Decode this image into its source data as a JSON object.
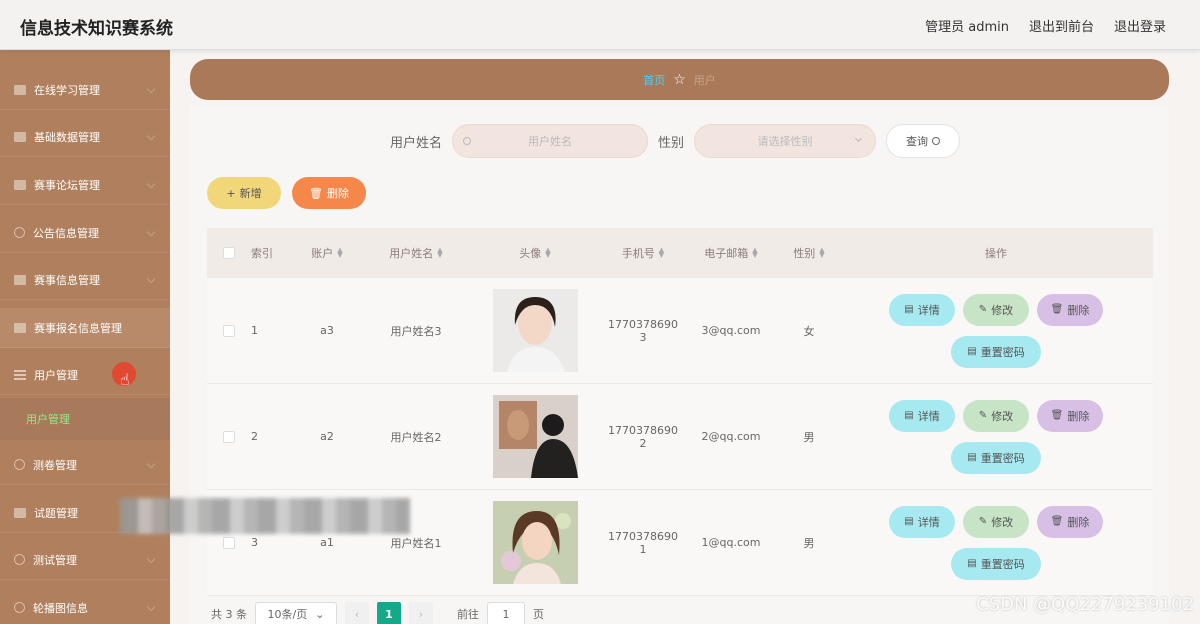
{
  "header": {
    "title": "信息技术知识赛系统",
    "nav": [
      "管理员 admin",
      "退出到前台",
      "退出登录"
    ]
  },
  "sidebar": {
    "items": [
      {
        "label": "在线学习管理",
        "icon": "folder-icon"
      },
      {
        "label": "基础数据管理",
        "icon": "folder-icon"
      },
      {
        "label": "赛事论坛管理",
        "icon": "folder-icon"
      },
      {
        "label": "公告信息管理",
        "icon": "circle-icon"
      },
      {
        "label": "赛事信息管理",
        "icon": "folder-icon"
      },
      {
        "label": "赛事报名信息管理",
        "icon": "folder-icon"
      },
      {
        "label": "用户管理",
        "icon": "menu-icon"
      },
      {
        "label": "测卷管理",
        "icon": "circle-icon"
      },
      {
        "label": "试题管理",
        "icon": "folder-icon"
      },
      {
        "label": "测试管理",
        "icon": "circle-icon"
      },
      {
        "label": "轮播图信息",
        "icon": "circle-icon"
      }
    ],
    "active_sub": "用户管理"
  },
  "breadcrumb": {
    "home": "首页",
    "current": "用户"
  },
  "search": {
    "name_label": "用户姓名",
    "name_placeholder": "用户姓名",
    "gender_label": "性别",
    "gender_placeholder": "请选择性别",
    "query_label": "查询"
  },
  "toolbar": {
    "add_label": "新增",
    "delete_label": "删除"
  },
  "table": {
    "headers": [
      "索引",
      "账户",
      "用户姓名",
      "头像",
      "手机号",
      "电子邮箱",
      "性别",
      "操作"
    ],
    "rows": [
      {
        "index": "1",
        "account": "a3",
        "name": "用户姓名3",
        "phone_line1": "1770378690",
        "phone_line2": "3",
        "email": "3@qq.com",
        "gender": "女"
      },
      {
        "index": "2",
        "account": "a2",
        "name": "用户姓名2",
        "phone_line1": "1770378690",
        "phone_line2": "2",
        "email": "2@qq.com",
        "gender": "男"
      },
      {
        "index": "3",
        "account": "a1",
        "name": "用户姓名1",
        "phone_line1": "1770378690",
        "phone_line2": "1",
        "email": "1@qq.com",
        "gender": "男"
      }
    ],
    "actions": {
      "detail": "详情",
      "edit": "修改",
      "remove": "删除",
      "reset": "重置密码"
    }
  },
  "pagination": {
    "total": "共 3 条",
    "page_size": "10条/页",
    "current_page": "1",
    "goto_label": "前往",
    "goto_value": "1",
    "page_suffix": "页"
  },
  "watermark": "CSDN @QQ2279239102",
  "colors": {
    "sidebar": "#b0805e",
    "breadcrumb": "#a9795a",
    "add_button": "#f1d77a",
    "delete_button": "#f5874a",
    "pagination_active": "#16a88a"
  }
}
